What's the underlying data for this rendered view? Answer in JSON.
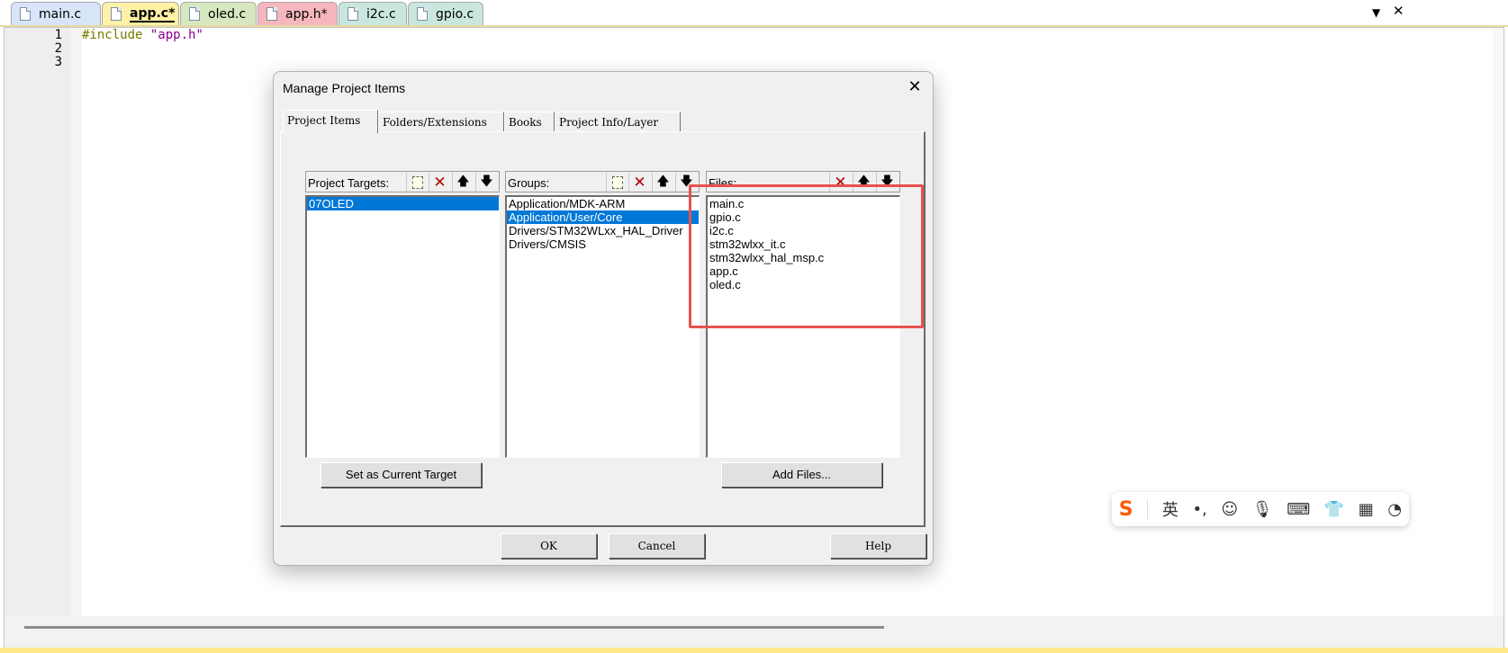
{
  "tabs": [
    {
      "label": "main.c",
      "color": "#d8e4f8",
      "active": false
    },
    {
      "label": "app.c*",
      "color": "#fff1a6",
      "active": true
    },
    {
      "label": "oled.c",
      "color": "#d7e8c0",
      "active": false
    },
    {
      "label": "app.h*",
      "color": "#f5b7bd",
      "active": false
    },
    {
      "label": "i2c.c",
      "color": "#c9e7de",
      "active": false
    },
    {
      "label": "gpio.c",
      "color": "#c9e7de",
      "active": false
    }
  ],
  "strip_controls": {
    "dropdown_icon": "chevron-down-icon",
    "close_icon": "close-icon",
    "dropdown": "▼",
    "close": "✕"
  },
  "editor": {
    "line_numbers": [
      "1",
      "2",
      "3"
    ],
    "line1_directive": "#include",
    "line1_string": "\"app.h\""
  },
  "dialog": {
    "title": "Manage Project Items",
    "close": "✕",
    "tabs": [
      "Project Items",
      "Folders/Extensions",
      "Books",
      "Project Info/Layer"
    ],
    "targets": {
      "caption": "Project Targets:",
      "items": [
        "07OLED"
      ],
      "selected": 0
    },
    "groups": {
      "caption": "Groups:",
      "items": [
        "Application/MDK-ARM",
        "Application/User/Core",
        "Drivers/STM32WLxx_HAL_Driver",
        "Drivers/CMSIS"
      ],
      "selected": 1
    },
    "files": {
      "caption": "Files:",
      "items": [
        "main.c",
        "gpio.c",
        "i2c.c",
        "stm32wlxx_it.c",
        "stm32wlxx_hal_msp.c",
        "app.c",
        "oled.c"
      ]
    },
    "toolbar": {
      "new": "",
      "delete": "✕",
      "up": "🡅",
      "down": "🡇"
    },
    "buttons": {
      "set_current": "Set as Current Target",
      "add_files": "Add Files...",
      "ok": "OK",
      "cancel": "Cancel",
      "help": "Help"
    },
    "highlight_color": "#e8524d"
  },
  "ime": {
    "logo": "S",
    "lang": "英",
    "punct": "•,",
    "emoji": "☺",
    "mic": "🎙",
    "keyboard": "⌨",
    "skin": "👕",
    "apps": "▦",
    "extra": "◔"
  }
}
